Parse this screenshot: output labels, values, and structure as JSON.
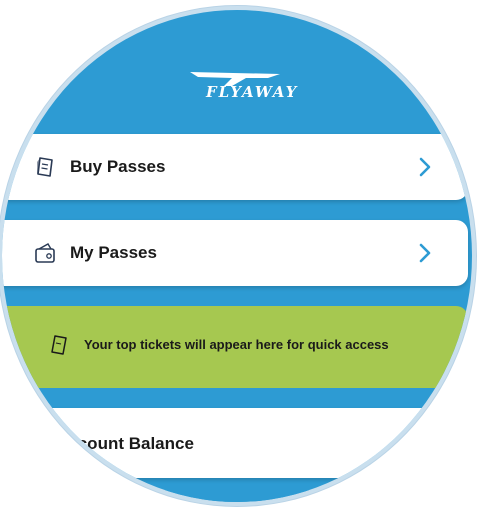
{
  "header": {
    "logo_text": "FLYAWAY",
    "logo_icon": "airplane-wing-logo"
  },
  "menu": {
    "buy_passes": {
      "label": "Buy Passes",
      "icon": "ticket-icon"
    },
    "my_passes": {
      "label": "My Passes",
      "icon": "wallet-icon"
    }
  },
  "quick_access": {
    "message": "Your top tickets will appear here for quick access",
    "icon": "ticket-outline-icon"
  },
  "account": {
    "balance_label": "Account Balance"
  },
  "colors": {
    "background_blue": "#2d9bd3",
    "quick_access_green": "#a6c850",
    "card_white": "#ffffff",
    "chevron_blue": "#2d9bd3"
  }
}
